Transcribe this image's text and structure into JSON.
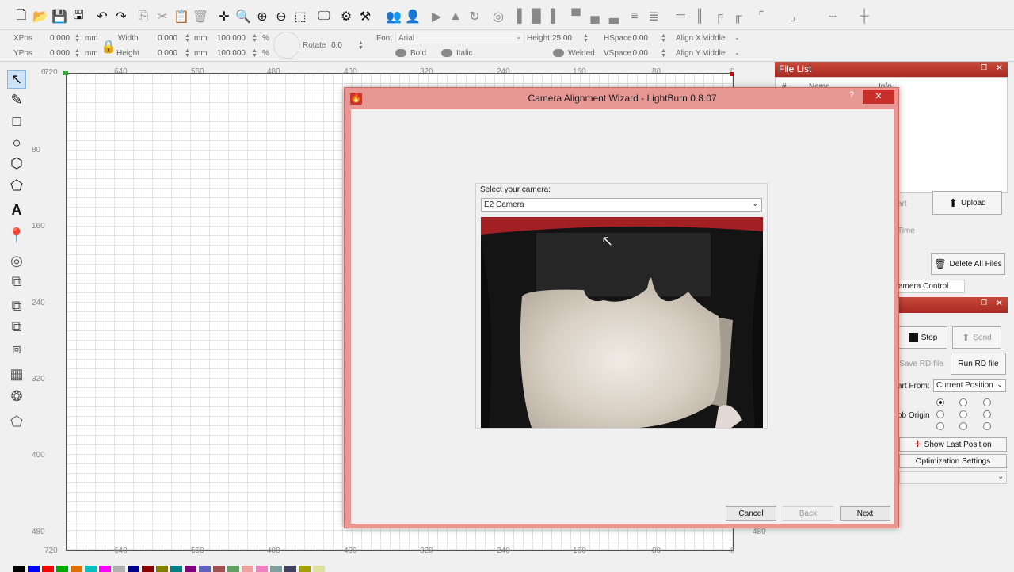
{
  "toolbar": {
    "icons": [
      "new-file",
      "open-folder",
      "save",
      "save-as",
      "undo",
      "redo",
      "copy",
      "cut",
      "paste",
      "delete",
      "move",
      "zoom-in",
      "zoom-plus",
      "zoom-minus",
      "zoom-frame",
      "monitor",
      "settings",
      "tools"
    ]
  },
  "props": {
    "xpos_label": "XPos",
    "xpos_value": "0.000",
    "ypos_label": "YPos",
    "ypos_value": "0.000",
    "unit": "mm",
    "width_label": "Width",
    "width_value": "0.000",
    "height_label": "Height",
    "height_value": "0.000",
    "pct1": "100.000",
    "pct2": "100.000",
    "pct": "%",
    "rotate_label": "Rotate",
    "rotate_value": "0.0",
    "font_label": "Font",
    "font_value": "Arial",
    "fheight_label": "Height",
    "fheight_value": "25.00",
    "hspace_label": "HSpace",
    "hspace_value": "0.00",
    "vspace_label": "VSpace",
    "vspace_value": "0.00",
    "alignx_label": "Align X",
    "alignx_value": "Middle",
    "aligny_label": "Align Y",
    "aligny_value": "Middle",
    "bold_label": "Bold",
    "italic_label": "Italic",
    "welded_label": "Welded"
  },
  "ruler": {
    "top": [
      "720",
      "640",
      "560",
      "480",
      "400",
      "320",
      "240",
      "160",
      "80",
      "0"
    ],
    "bottom": [
      "720",
      "640",
      "560",
      "480",
      "400",
      "320",
      "240",
      "160",
      "80",
      "0"
    ],
    "left": [
      "0",
      "80",
      "160",
      "240",
      "320",
      "400",
      "480"
    ],
    "right_bottom": "480"
  },
  "palette": [
    "#000000",
    "#0000ff",
    "#ff0000",
    "#00aa00",
    "#e07000",
    "#00c0c0",
    "#ff00ff",
    "#b0b0b0",
    "#00008b",
    "#8b0000",
    "#808000",
    "#008080",
    "#800080",
    "#6060c0",
    "#a05050",
    "#60a060",
    "#f0a0a0",
    "#f080c0",
    "#80a0a0",
    "#404060",
    "#a0a000",
    "#e0e0a0"
  ],
  "file_list": {
    "title": "File List",
    "col_num": "#",
    "col_name": "Name",
    "col_info": "Info",
    "start_label": "art",
    "upload_label": "Upload",
    "time_label": "Time",
    "delete_all_label": "Delete All Files"
  },
  "laser": {
    "tab_label": "amera Control",
    "stop_label": "Stop",
    "send_label": "Send",
    "save_rd_label": "Save RD file",
    "run_rd_label": "Run RD file",
    "start_from_label": "art From:",
    "start_from_value": "Current Position",
    "job_origin_label": "ob Origin",
    "show_last_label": "Show Last Position",
    "optimization_label": "Optimization Settings"
  },
  "dialog": {
    "title": "Camera Alignment Wizard - LightBurn 0.8.07",
    "help": "?",
    "close": "✕",
    "select_label": "Select your camera:",
    "camera_value": "E2 Camera",
    "cancel_label": "Cancel",
    "back_label": "Back",
    "next_label": "Next"
  }
}
